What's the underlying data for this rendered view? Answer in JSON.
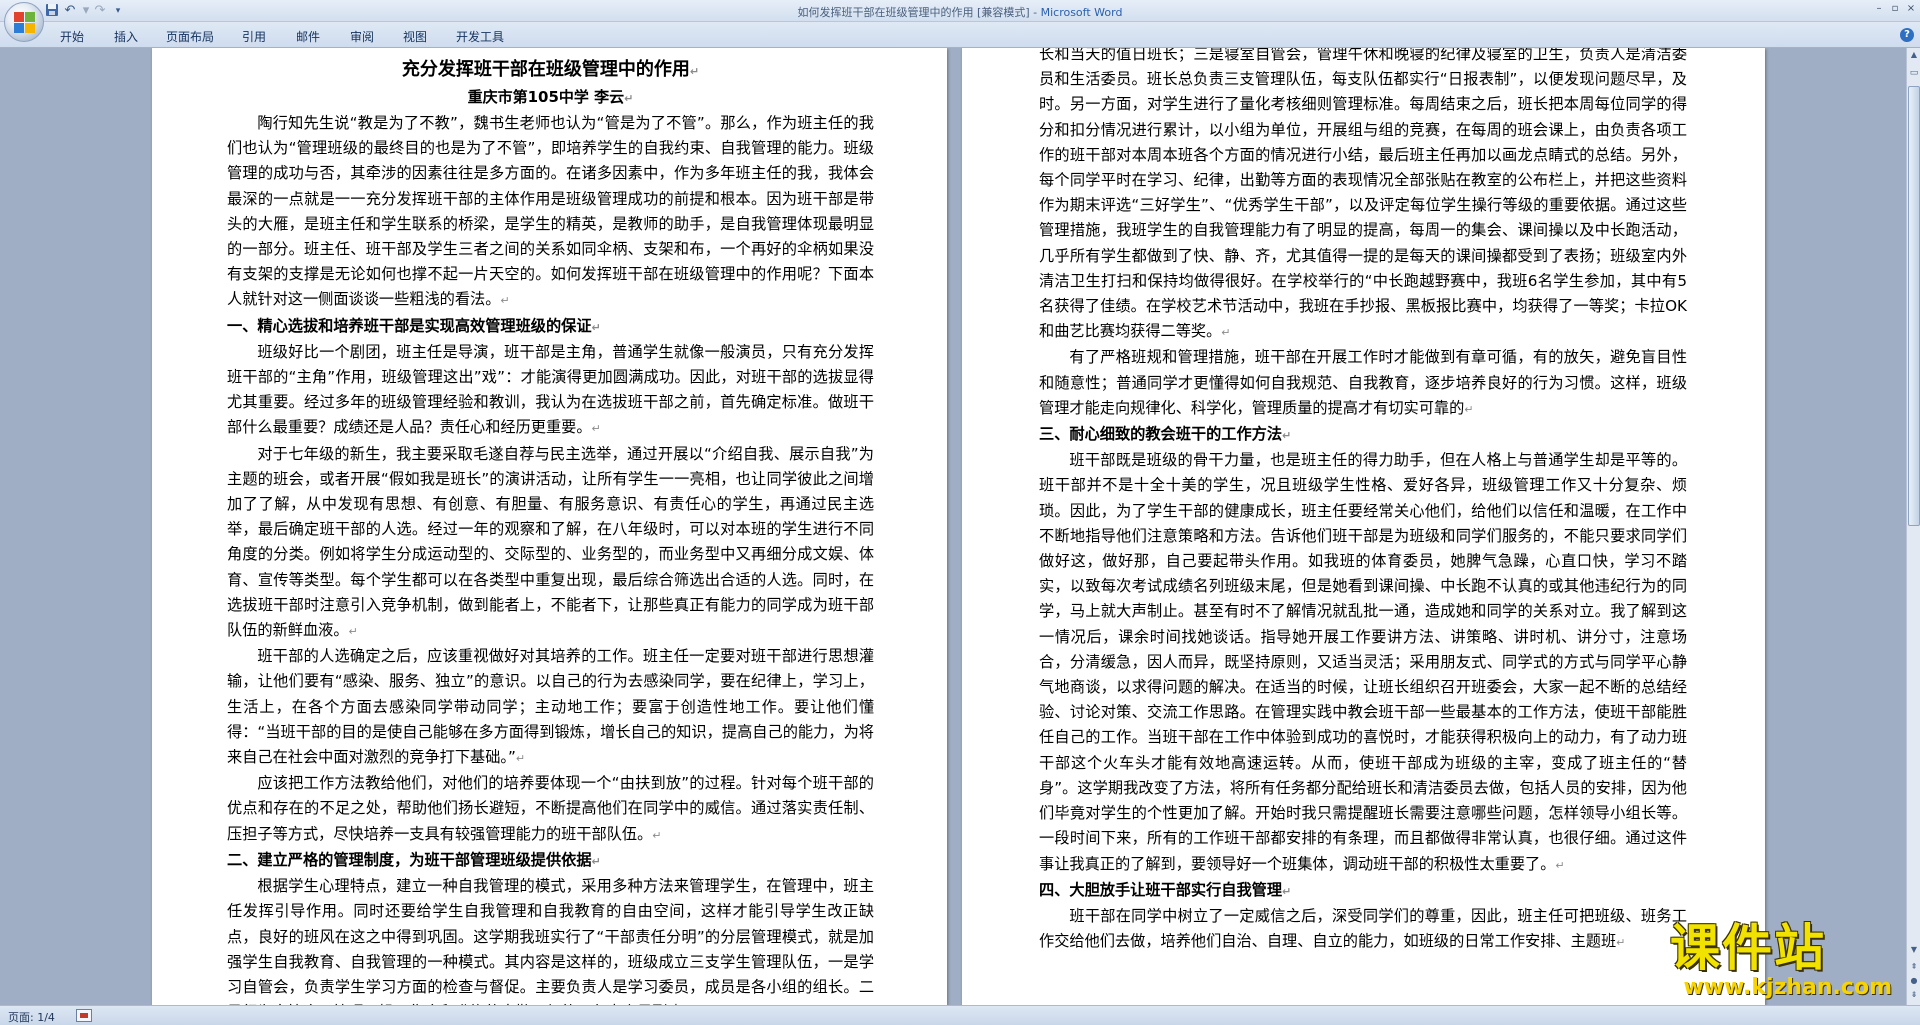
{
  "window": {
    "title_doc": "如何发挥班干部在班级管理中的作用 [兼容模式] - ",
    "title_app": "Microsoft Word"
  },
  "quick_access": {
    "save_icon": "save-icon",
    "undo_icon": "undo-icon",
    "redo_icon": "redo-icon",
    "customize_icon": "dropdown-icon"
  },
  "ribbon": {
    "tabs": [
      "开始",
      "插入",
      "页面布局",
      "引用",
      "邮件",
      "审阅",
      "视图",
      "开发工具"
    ]
  },
  "document": {
    "left_page": {
      "title": "充分发挥班干部在班级管理中的作用",
      "byline": "重庆市第105中学   李云",
      "paragraphs": [
        {
          "type": "p",
          "text": "陶行知先生说“教是为了不教”，魏书生老师也认为“管是为了不管”。那么，作为班主任的我们也认为“管理班级的最终目的也是为了不管”，即培养学生的自我约束、自我管理的能力。班级管理的成功与否，其牵涉的因素往往是多方面的。在诸多因素中，作为多年班主任的我，我体会最深的一点就是一一充分发挥班干部的主体作用是班级管理成功的前提和根本。因为班干部是带头的大雁，是班主任和学生联系的桥梁，是学生的精英，是教师的助手，是自我管理体现最明显的一部分。班主任、班干部及学生三者之间的关系如同伞柄、支架和布，一个再好的伞柄如果没有支架的支撑是无论如何也撑不起一片天空的。如何发挥班干部在班级管理中的作用呢？下面本人就针对这一侧面谈谈一些粗浅的看法。"
        },
        {
          "type": "sec",
          "text": "一、精心选拔和培养班干部是实现高效管理班级的保证"
        },
        {
          "type": "p",
          "text": "班级好比一个剧团，班主任是导演，班干部是主角，普通学生就像一般演员，只有充分发挥班干部的“主角”作用，班级管理这出”戏”：才能演得更加圆满成功。因此，对班干部的选拔显得尤其重要。经过多年的班级管理经验和教训，我认为在选拔班干部之前，首先确定标准。做班干部什么最重要？成绩还是人品？责任心和经历更重要。"
        },
        {
          "type": "p",
          "text": "对于七年级的新生，我主要采取毛遂自荐与民主选举，通过开展以“介绍自我、展示自我”为主题的班会，或者开展“假如我是班长”的演讲活动，让所有学生一一亮相，也让同学彼此之间增加了了解，从中发现有思想、有创意、有胆量、有服务意识、有责任心的学生，再通过民主选举，最后确定班干部的人选。经过一年的观察和了解，在八年级时，可以对本班的学生进行不同角度的分类。例如将学生分成运动型的、交际型的、业务型的，而业务型中又再细分成文娱、体育、宣传等类型。每个学生都可以在各类型中重复出现，最后综合筛选出合适的人选。同时，在选拔班干部时注意引入竞争机制，做到能者上，不能者下，让那些真正有能力的同学成为班干部队伍的新鲜血液。"
        },
        {
          "type": "p",
          "text": "班干部的人选确定之后，应该重视做好对其培养的工作。班主任一定要对班干部进行思想灌输，让他们要有“感染、服务、独立”的意识。以自己的行为去感染同学，要在纪律上，学习上，生活上，在各个方面去感染同学带动同学；主动地工作；要富于创造性地工作。要让他们懂得：“当班干部的目的是使自己能够在多方面得到锻炼，增长自己的知识，提高自己的能力，为将来自己在社会中面对激烈的竞争打下基础。”"
        },
        {
          "type": "p",
          "text": "应该把工作方法教给他们，对他们的培养要体现一个“由扶到放”的过程。针对每个班干部的优点和存在的不足之处，帮助他们扬长避短，不断提高他们在同学中的威信。通过落实责任制、压担子等方式，尽快培养一支具有较强管理能力的班干部队伍。"
        },
        {
          "type": "sec",
          "text": "二、建立严格的管理制度，为班干部管理班级提供依据"
        },
        {
          "type": "p",
          "text": "根据学生心理特点，建立一种自我管理的模式，采用多种方法来管理学生，在管理中，班主任发挥引导作用。同时还要给学生自我管理和自我教育的自由空间，这样才能引导学生改正缺点，良好的班风在这之中得到巩固。这学期我班实行了“干部责任分明”的分层管理模式，就是加强学生自我教育、自我管理的一种模式。其内容是这样的，班级成立三支学生管理队伍，一是学习自管会，负责学生学习方面的检查与督促。主要负责人是学习委员，成员是各小组的组长。二是行为自管会，管理两操、集会和升旗的出勤、纪律，负责人是副班"
        }
      ]
    },
    "right_page": {
      "paragraphs": [
        {
          "type": "cont",
          "text": "长和当天的值日班长；三是寝室自管会，管理午休和晚寝的纪律及寝室的卫生，负责人是清洁委员和生活委员。班长总负责三支管理队伍，每支队伍都实行“日报表制”，以便发现问题尽早，及时。另一方面，对学生进行了量化考核细则管理标准。每周结束之后，班长把本周每位同学的得分和扣分情况进行累计，以小组为单位，开展组与组的竞赛，在每周的班会课上，由负责各项工作的班干部对本周本班各个方面的情况进行小结，最后班主任再加以画龙点睛式的总结。另外，每个同学平时在学习、纪律，出勤等方面的表现情况全部张贴在教室的公布栏上，并把这些资料作为期末评选“三好学生”、“优秀学生干部”，以及评定每位学生操行等级的重要依据。通过这些管理措施，我班学生的自我管理能力有了明显的提高，每周一的集会、课间操以及中长跑活动，几乎所有学生都做到了快、静、齐，尤其值得一提的是每天的课间操都受到了表扬；班级室内外清洁卫生打扫和保持均做得很好。在学校举行的“中长跑越野赛中，我班6名学生参加，其中有5名获得了佳绩。在学校艺术节活动中，我班在手抄报、黑板报比赛中，均获得了一等奖；卡拉OK 和曲艺比赛均获得二等奖。"
        },
        {
          "type": "p",
          "text": "有了严格班规和管理措施，班干部在开展工作时才能做到有章可循，有的放矢，避免盲目性和随意性；普通同学才更懂得如何自我规范、自我教育，逐步培养良好的行为习惯。这样，班级管理才能走向规律化、科学化，管理质量的提高才有切实可靠的"
        },
        {
          "type": "sec",
          "text": "三、耐心细致的教会班干的工作方法"
        },
        {
          "type": "p",
          "text": "班干部既是班级的骨干力量，也是班主任的得力助手，但在人格上与普通学生却是平等的。班干部并不是十全十美的学生，况且班级学生性格、爱好各异，班级管理工作又十分复杂、烦琐。因此，为了学生干部的健康成长，班主任要经常关心他们，给他们以信任和温暖，在工作中不断地指导他们注意策略和方法。告诉他们班干部是为班级和同学们服务的，不能只要求同学们做好这，做好那，自己要起带头作用。如我班的体育委员，她脾气急躁，心直口快，学习不踏实，以致每次考试成绩名列班级末尾，但是她看到课间操、中长跑不认真的或其他违纪行为的同学，马上就大声制止。甚至有时不了解情况就乱批一通，造成她和同学的关系对立。我了解到这一情况后，课余时间找她谈话。指导她开展工作要讲方法、讲策略、讲时机、讲分寸，注意场合，分清缓急，因人而异，既坚持原则，又适当灵活；采用朋友式、同学式的方式与同学平心静气地商谈，以求得问题的解决。在适当的时候，让班长组织召开班委会，大家一起不断的总结经验、讨论对策、交流工作思路。在管理实践中教会班干部一些最基本的工作方法，使班干部能胜任自己的工作。当班干部在工作中体验到成功的喜悦时，才能获得积极向上的动力，有了动力班干部这个火车头才能有效地高速运转。从而，使班干部成为班级的主宰，变成了班主任的“替身”。这学期我改变了方法，将所有任务都分配给班长和清洁委员去做，包括人员的安排，因为他们毕竟对学生的个性更加了解。开始时我只需提醒班长需要注意哪些问题，怎样领导小组长等。一段时间下来，所有的工作班干部都安排的有条理，而且都做得非常认真，也很仔细。通过这件事让我真正的了解到，要领导好一个班集体，调动班干部的积极性太重要了。"
        },
        {
          "type": "sec",
          "text": "四、大胆放手让班干部实行自我管理"
        },
        {
          "type": "p",
          "text": "班干部在同学中树立了一定威信之后，深受同学们的尊重，因此，班主任可把班级、班务工作交给他们去做，培养他们自治、自理、自立的能力，如班级的日常工作安排、主题班"
        }
      ]
    }
  },
  "statusbar": {
    "page_info": "页面: 1/4"
  },
  "watermark": {
    "logo_text": "课件站",
    "url": "www.kjzhan.com"
  },
  "colors": {
    "workspace": "#9faec4",
    "ribbon": "#d3dfef",
    "title_app": "#2a5fae",
    "watermark_yellow": "#f2e200"
  }
}
